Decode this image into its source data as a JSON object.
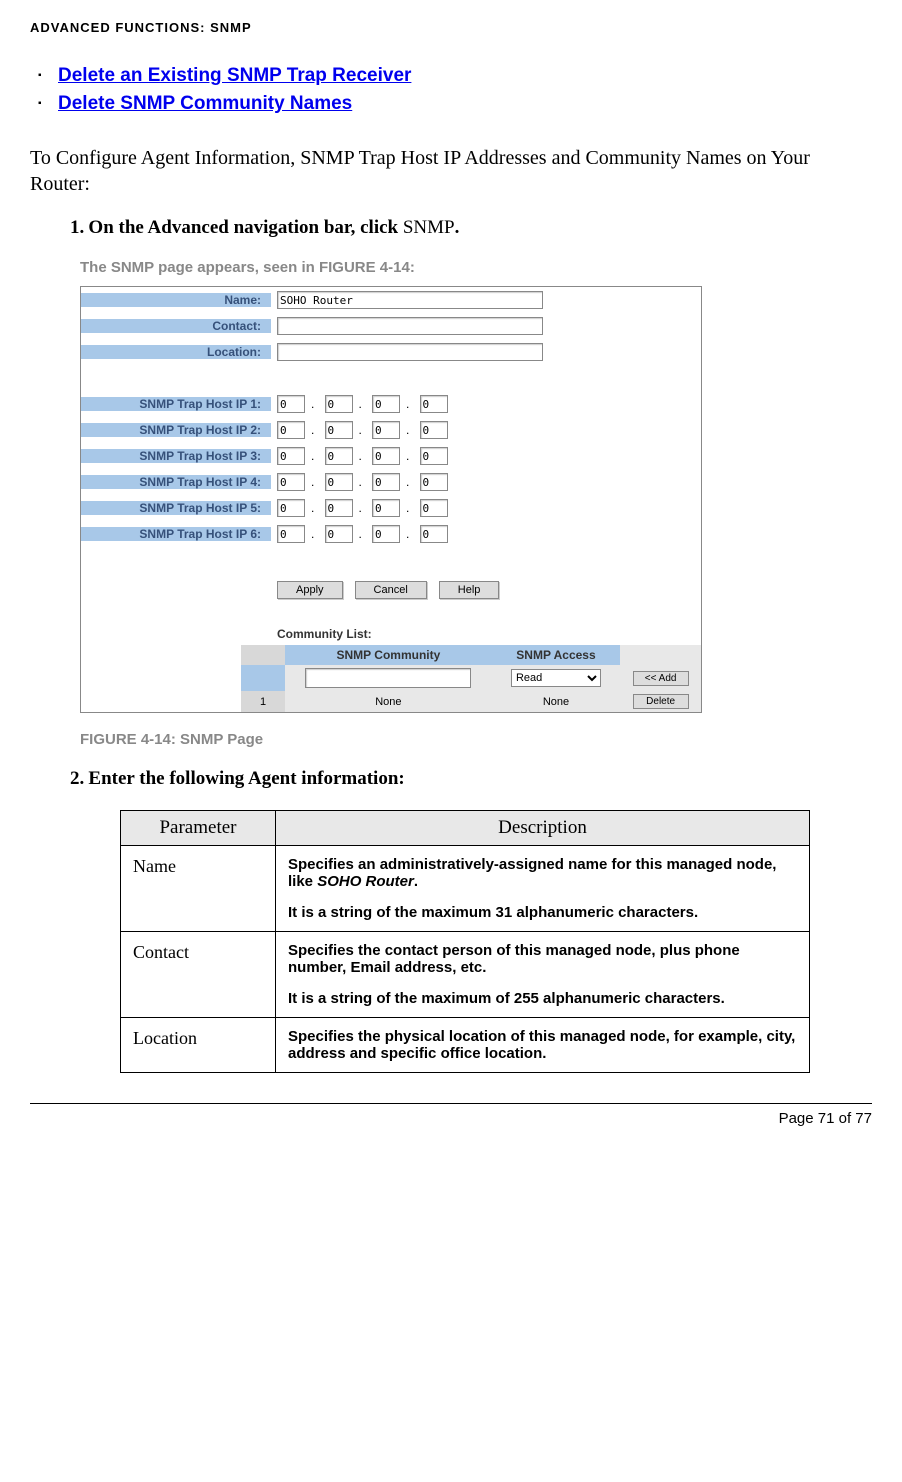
{
  "header": "ADVANCED FUNCTIONS: SNMP",
  "links": [
    "Delete an Existing SNMP Trap Receiver",
    "Delete SNMP Community Names"
  ],
  "intro": "To Configure Agent Information, SNMP Trap Host IP Addresses and Community Names on Your Router:",
  "step1": {
    "num": "1.",
    "bold": "On the Advanced navigation bar, click ",
    "normal": "SNMP",
    "end": "."
  },
  "fig_intro": {
    "pre": "The SNMP page appears, seen in ",
    "ref": "FIGURE 4-14",
    "post": ":"
  },
  "fig": {
    "labels": {
      "name": "Name:",
      "contact": "Contact:",
      "location": "Location:",
      "ip1": "SNMP Trap Host IP 1:",
      "ip2": "SNMP Trap Host IP 2:",
      "ip3": "SNMP Trap Host IP 3:",
      "ip4": "SNMP Trap Host IP 4:",
      "ip5": "SNMP Trap Host IP 5:",
      "ip6": "SNMP Trap Host IP 6:"
    },
    "name_value": "SOHO Router",
    "ip_value": "0",
    "buttons": {
      "apply": "Apply",
      "cancel": "Cancel",
      "help": "Help"
    },
    "community_label": "Community List:",
    "community_headers": {
      "comm": "SNMP Community",
      "acc": "SNMP Access"
    },
    "community_row": {
      "num": "1",
      "comm": "None",
      "acc": "None",
      "select": "Read",
      "add": "<< Add",
      "del": "Delete"
    }
  },
  "fig_caption": "FIGURE 4-14: SNMP Page",
  "step2": {
    "num": "2.",
    "text": "Enter the following Agent information:"
  },
  "table": {
    "h1": "Parameter",
    "h2": "Description",
    "rows": [
      {
        "name": "Name",
        "desc_p1a": "Specifies an administratively-assigned name for this managed node, like ",
        "desc_p1b": "SOHO Router",
        "desc_p1c": ".",
        "desc_p2": "It is a string of the maximum 31 alphanumeric characters."
      },
      {
        "name": "Contact",
        "desc_p1": "Specifies the contact person of this managed node, plus phone number, Email address, etc.",
        "desc_p2": "It is a string of the maximum of 255 alphanumeric characters."
      },
      {
        "name": "Location",
        "desc_p1": "Specifies the physical location of this managed node, for example, city, address and specific office location."
      }
    ]
  },
  "footer": "Page 71 of 77"
}
